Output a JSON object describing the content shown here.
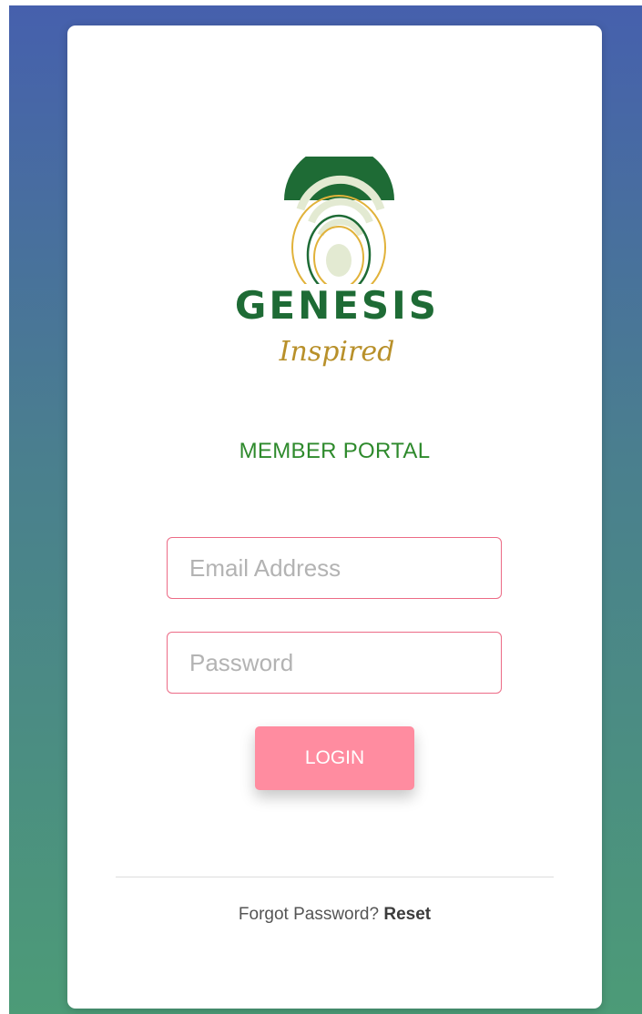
{
  "brand": {
    "name": "GENESIS",
    "tagline": "Inspired",
    "colors": {
      "green": "#1e6b35",
      "gold": "#b8902a",
      "pale_green": "#e3ead2"
    }
  },
  "portal": {
    "title": "MEMBER PORTAL"
  },
  "form": {
    "email_placeholder": "Email Address",
    "email_value": "",
    "password_placeholder": "Password",
    "password_value": "",
    "login_label": "LOGIN"
  },
  "footer": {
    "forgot_text": "Forgot Password?",
    "reset_label": "Reset"
  },
  "colors": {
    "accent_pink": "#ff8ca0",
    "field_border": "#ec6b86",
    "title_green": "#2e8a2c",
    "background_top": "#4660ad",
    "background_bottom": "#4c9b77"
  }
}
